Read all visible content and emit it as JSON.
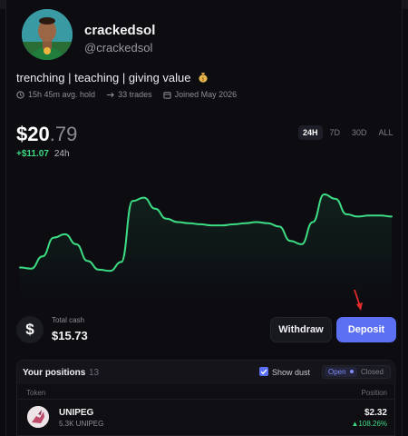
{
  "profile": {
    "name": "crackedsol",
    "handle": "@crackedsol",
    "bio": "trenching | teaching | giving value",
    "stats": {
      "hold_time": "15h 45m avg. hold",
      "trades": "33 trades",
      "joined": "Joined May 2026"
    }
  },
  "portfolio": {
    "price_whole": "$20",
    "price_cents": ".79",
    "change": "+$11.07",
    "change_period": "24h",
    "ranges": [
      "24H",
      "7D",
      "30D",
      "ALL"
    ],
    "active_range": "24H"
  },
  "chart_data": {
    "type": "line",
    "series": [
      {
        "values": [
          0.25,
          0.24,
          0.35,
          0.52,
          0.55,
          0.46,
          0.31,
          0.23,
          0.22,
          0.3,
          0.85,
          0.88,
          0.78,
          0.69,
          0.66,
          0.65,
          0.64,
          0.63,
          0.63,
          0.64,
          0.65,
          0.66,
          0.65,
          0.62,
          0.49,
          0.46,
          0.66,
          0.91,
          0.87,
          0.73,
          0.71,
          0.72,
          0.72,
          0.71
        ]
      }
    ]
  },
  "cash": {
    "label": "Total cash",
    "value": "$15.73",
    "icon": "dollar-icon"
  },
  "actions": {
    "withdraw": "Withdraw",
    "deposit": "Deposit"
  },
  "positions": {
    "title": "Your positions",
    "count": "13",
    "show_dust": "Show dust",
    "toggle_open": "Open",
    "toggle_closed": "Closed",
    "col_token": "Token",
    "col_position": "Position",
    "rows": [
      {
        "name": "UNIPEG",
        "amount": "5.3K UNIPEG",
        "value": "$2.32",
        "change": "▲108.26%"
      }
    ]
  },
  "colors": {
    "accent": "#5b70f3",
    "positive": "#3ddc84",
    "background": "#0c0c11"
  }
}
